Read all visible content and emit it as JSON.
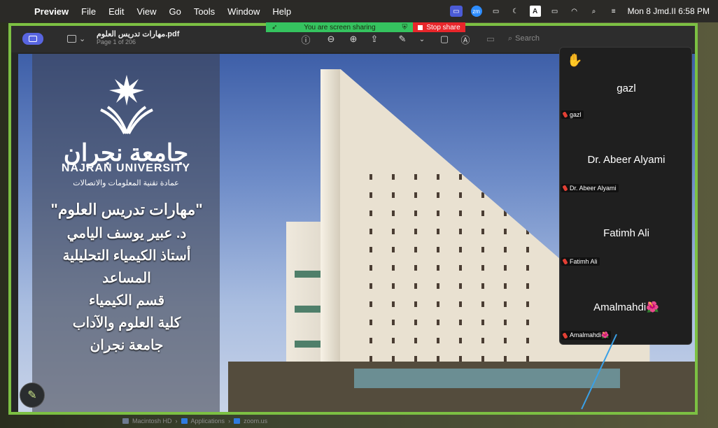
{
  "menubar": {
    "apple_glyph": "",
    "app_name": "Preview",
    "items": [
      "File",
      "Edit",
      "View",
      "Go",
      "Tools",
      "Window",
      "Help"
    ],
    "status": {
      "zoom_badge": "zm",
      "input_badge": "A",
      "clock": "Mon 8 Jmd.II 6:58 PM"
    }
  },
  "share": {
    "status": "You are screen sharing",
    "stop_label": "Stop share"
  },
  "preview": {
    "title": "مهارات تدريس العلوم.pdf",
    "subtitle": "Page 1 of 206",
    "search_placeholder": "Search"
  },
  "slide": {
    "uni_ar": "جامعة نجران",
    "uni_en": "NAJRAN UNIVERSITY",
    "uni_dept": "عمادة تقنية المعلومات والاتصالات",
    "lines": [
      "\"مهارات تدريس العلوم\"",
      "د. عبير يوسف اليامي",
      "أستاذ الكيمياء التحليلية",
      "المساعد",
      "قسم الكيمياء",
      "كلية العلوم والآداب",
      "جامعة نجران"
    ]
  },
  "zoom": {
    "participants": [
      {
        "name": "gazl",
        "label": "gazl"
      },
      {
        "name": "Dr. Abeer Alyami",
        "label": "Dr. Abeer Alyami"
      },
      {
        "name": "Fatimh Ali",
        "label": "Fatimh Ali"
      },
      {
        "name": "Amalmahdi🌺",
        "label": "Amalmahdi🌺"
      }
    ]
  },
  "path": [
    "Macintosh HD",
    "Applications",
    "zoom.us"
  ],
  "colors": {
    "share_green": "#35c35f",
    "stop_red": "#e8262b",
    "frame_green": "#7cc043",
    "accent": "#5865e0"
  }
}
